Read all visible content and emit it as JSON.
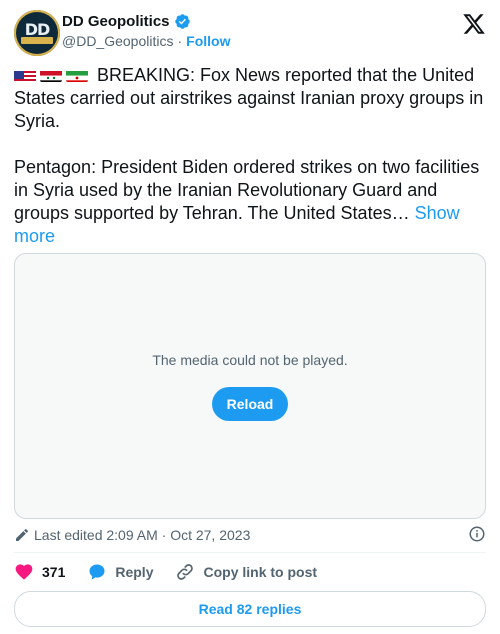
{
  "author": {
    "avatar_text": "DD",
    "display_name": "DD Geopolitics",
    "handle": "@DD_Geopolitics",
    "separator": "·",
    "follow_label": "Follow",
    "verified": true
  },
  "tweet": {
    "flags": [
      "flag-usa-icon",
      "flag-syria-icon",
      "flag-iran-icon"
    ],
    "text_line1": "BREAKING: Fox News reported that the United States carried out airstrikes against Iranian proxy groups in Syria.",
    "text_line2": "Pentagon: President Biden ordered strikes on two facilities in Syria used by the Iranian Revolutionary Guard and groups supported by Tehran. The United States…",
    "show_more_label": "Show more"
  },
  "media": {
    "error_message": "The media could not be played.",
    "reload_label": "Reload"
  },
  "meta": {
    "edited_text": "Last edited 2:09 AM · Oct 27, 2023"
  },
  "actions": {
    "likes_count": "371",
    "reply_label": "Reply",
    "copy_link_label": "Copy link to post"
  },
  "footer": {
    "read_replies_label": "Read 82 replies"
  },
  "colors": {
    "accent": "#1d9bf0",
    "like": "#f91880",
    "muted": "#536471"
  }
}
